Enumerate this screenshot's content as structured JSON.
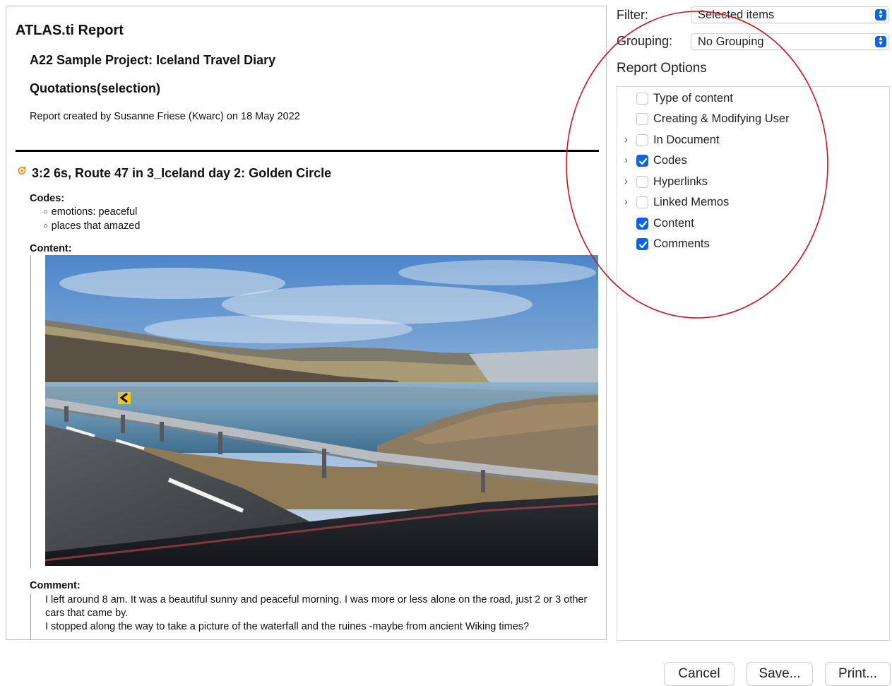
{
  "report": {
    "title": "ATLAS.ti Report",
    "project": "A22 Sample Project: Iceland Travel Diary",
    "section": "Quotations(selection)",
    "created": "Report created by Susanne Friese (Kwarc) on 18 May 2022",
    "quotation": {
      "title": "3:2 6s, Route 47 in 3_Iceland day 2: Golden Circle",
      "codes_label": "Codes:",
      "codes": [
        "emotions: peaceful",
        "places that amazed"
      ],
      "content_label": "Content:",
      "comment_label": "Comment:",
      "comment_lines": [
        "I left around 8 am. It was a beautiful sunny and peaceful morning. I was more or less alone on the road, just 2 or 3 other cars that came by.",
        "I stopped along the way to take a picture of the waterfall and the ruines -maybe from ancient Wiking times?"
      ]
    }
  },
  "filter": {
    "label": "Filter:",
    "value": "Selected items"
  },
  "grouping": {
    "label": "Grouping:",
    "value": "No Grouping"
  },
  "options": {
    "title": "Report Options",
    "items": [
      {
        "label": "Type of content",
        "checked": false,
        "expandable": false
      },
      {
        "label": "Creating & Modifying User",
        "checked": false,
        "expandable": false
      },
      {
        "label": "In Document",
        "checked": false,
        "expandable": true
      },
      {
        "label": "Codes",
        "checked": true,
        "expandable": true
      },
      {
        "label": "Hyperlinks",
        "checked": false,
        "expandable": true
      },
      {
        "label": "Linked Memos",
        "checked": false,
        "expandable": true
      },
      {
        "label": "Content",
        "checked": true,
        "expandable": false
      },
      {
        "label": "Comments",
        "checked": true,
        "expandable": false
      }
    ]
  },
  "buttons": {
    "cancel": "Cancel",
    "save": "Save...",
    "print": "Print..."
  },
  "colors": {
    "accent": "#0a63e8",
    "annotation": "#d0141c",
    "quote_icon": "#f08a1c"
  }
}
